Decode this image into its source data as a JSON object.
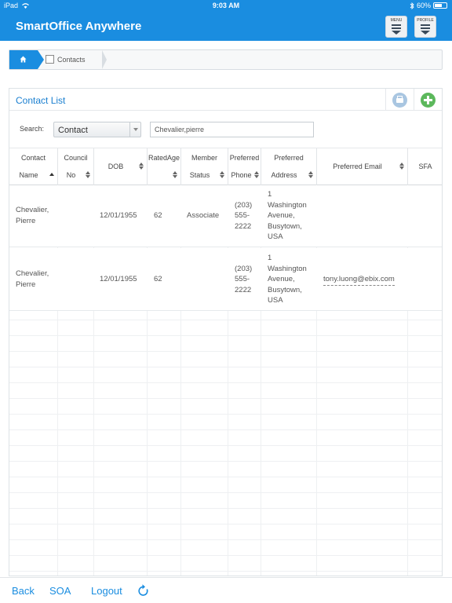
{
  "status_bar": {
    "device": "iPad",
    "time": "9:03 AM",
    "battery": "60%"
  },
  "header": {
    "title": "SmartOffice Anywhere",
    "menu_label": "MENU",
    "profile_label": "PROFILE"
  },
  "breadcrumb": {
    "current": "Contacts"
  },
  "panel": {
    "title": "Contact List",
    "search_label": "Search:",
    "search_type": "Contact",
    "search_value": "Chevalier,pierre"
  },
  "table": {
    "columns": [
      {
        "l1": "Contact",
        "l2": "Name"
      },
      {
        "l1": "Council",
        "l2": "No"
      },
      {
        "label": "DOB"
      },
      {
        "l1": "RatedAge",
        "l2": ""
      },
      {
        "l1": "Member",
        "l2": "Status"
      },
      {
        "l1": "Preferred",
        "l2": "Phone"
      },
      {
        "l1": "Preferred",
        "l2": "Address"
      },
      {
        "label": "Preferred Email"
      },
      {
        "label": "SFA"
      }
    ],
    "rows": [
      {
        "name_line1": "Chevalier,",
        "name_line2": "Pierre",
        "council_no": "",
        "dob": "12/01/1955",
        "rated_age": "62",
        "member_status": "Associate",
        "phone_line1": "(203)",
        "phone_line2": "555-",
        "phone_line3": "2222",
        "addr_line1": "1",
        "addr_line2": "Washington",
        "addr_line3": "Avenue,",
        "addr_line4": "Busytown,",
        "addr_line5": "USA",
        "email": "",
        "sfa": ""
      },
      {
        "name_line1": "Chevalier,",
        "name_line2": "Pierre",
        "council_no": "",
        "dob": "12/01/1955",
        "rated_age": "62",
        "member_status": "",
        "phone_line1": "(203)",
        "phone_line2": "555-",
        "phone_line3": "2222",
        "addr_line1": "1",
        "addr_line2": "Washington",
        "addr_line3": "Avenue,",
        "addr_line4": "Busytown,",
        "addr_line5": "USA",
        "email": "tony.luong@ebix.com",
        "sfa": ""
      }
    ]
  },
  "bottom_bar": {
    "back": "Back",
    "soa": "SOA",
    "logout": "Logout"
  },
  "colors": {
    "accent": "#1a8de0",
    "add": "#5cb85c"
  }
}
